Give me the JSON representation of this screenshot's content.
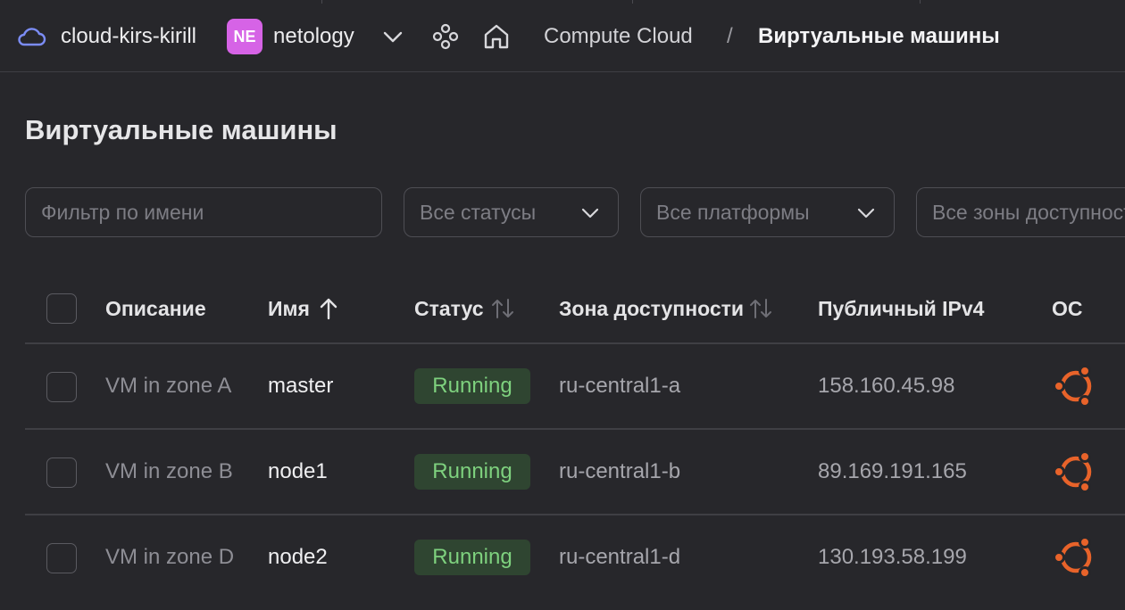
{
  "header": {
    "cloud_icon": "cloud-icon",
    "cloud_name": "cloud-kirs-kirill",
    "org_badge": "NE",
    "org_name": "netology",
    "org_dropdown_icon": "chevron-down-icon",
    "services_icon": "services-grid-icon",
    "home_icon": "home-icon",
    "breadcrumb": [
      "Compute Cloud",
      "/",
      "Виртуальные машины"
    ],
    "accent": "#d663e6"
  },
  "page": {
    "title": "Виртуальные машины"
  },
  "filters": {
    "name_placeholder": "Фильтр по имени",
    "status": "Все статусы",
    "platform": "Все платформы",
    "zone": "Все зоны доступности"
  },
  "table": {
    "columns": [
      "Описание",
      "Имя",
      "Статус",
      "Зона доступности",
      "Публичный IPv4",
      "ОС"
    ],
    "sort": {
      "column": "Имя",
      "direction": "ascending",
      "sortable": [
        "Статус",
        "Зона доступности"
      ]
    },
    "rows": [
      {
        "description": "VM in zone A",
        "name": "master",
        "status": "Running",
        "zone": "ru-central1-a",
        "ipv4": "158.160.45.98",
        "os_icon": "ubuntu-icon"
      },
      {
        "description": "VM in zone B",
        "name": "node1",
        "status": "Running",
        "zone": "ru-central1-b",
        "ipv4": "89.169.191.165",
        "os_icon": "ubuntu-icon"
      },
      {
        "description": "VM in zone D",
        "name": "node2",
        "status": "Running",
        "zone": "ru-central1-d",
        "ipv4": "130.193.58.199",
        "os_icon": "ubuntu-icon"
      }
    ],
    "status_color": "#7ed17e",
    "os_color": "#e8632a"
  }
}
